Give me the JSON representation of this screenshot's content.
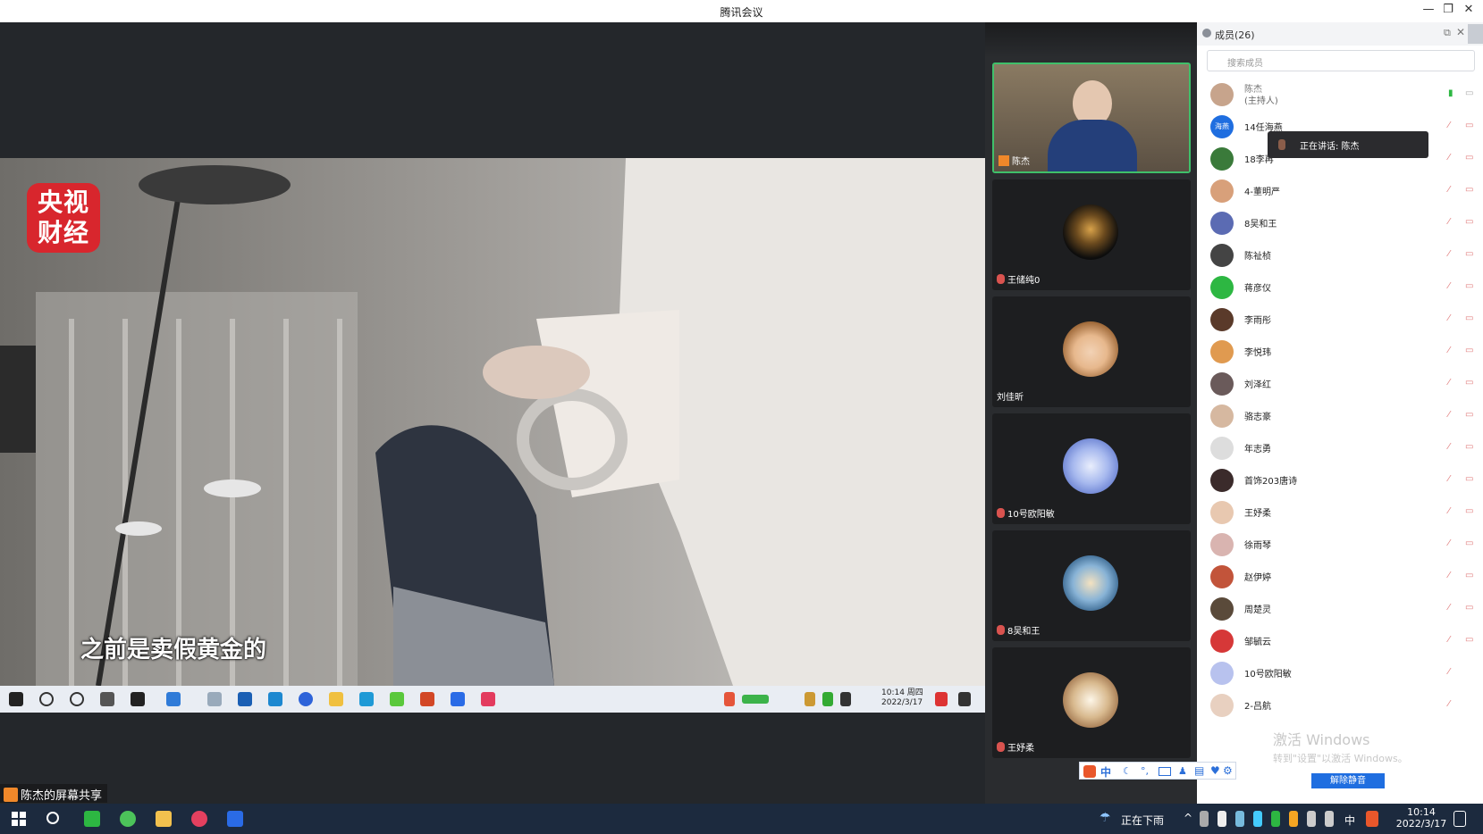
{
  "window": {
    "title": "腾讯会议",
    "controls": [
      "—",
      "❐",
      "✕"
    ]
  },
  "share": {
    "logo_text_1": "央视",
    "logo_text_2": "财经",
    "subtitle": "之前是卖假黄金的",
    "presenter_label": "陈杰的屏幕共享",
    "inner_clock_time": "10:14 周四",
    "inner_clock_date": "2022/3/17"
  },
  "gallery": {
    "tiles": [
      {
        "name": "陈杰",
        "active": true
      },
      {
        "name": "王储纯0"
      },
      {
        "name": "刘佳昕"
      },
      {
        "name": "10号欧阳敏"
      },
      {
        "name": "8吴和王"
      },
      {
        "name": "王妤柔"
      }
    ]
  },
  "members": {
    "title": "成员(26)",
    "search_placeholder": "搜索成员",
    "speaking_label": "正在讲话: 陈杰",
    "list": [
      {
        "name": "陈杰",
        "sub": "(主持人)"
      },
      {
        "name": "14任海燕",
        "avatar_text": "海燕"
      },
      {
        "name": "18李再"
      },
      {
        "name": "4-董明严"
      },
      {
        "name": "8吴和王"
      },
      {
        "name": "陈祉桢"
      },
      {
        "name": "蒋彦仪"
      },
      {
        "name": "李雨彤"
      },
      {
        "name": "李悦玮"
      },
      {
        "name": "刘泽红"
      },
      {
        "name": "骆志豪"
      },
      {
        "name": "年志勇"
      },
      {
        "name": "首饰203唐诗"
      },
      {
        "name": "王妤柔"
      },
      {
        "name": "徐雨琴"
      },
      {
        "name": "赵伊婷"
      },
      {
        "name": "周楚灵"
      },
      {
        "name": "邹毓云"
      },
      {
        "name": "10号欧阳敏"
      },
      {
        "name": "2-吕航"
      }
    ],
    "unmute_all": "解除静音",
    "activate_line1": "激活 Windows",
    "activate_line2": "转到\"设置\"以激活 Windows。"
  },
  "ime": {
    "label": "中"
  },
  "taskbar": {
    "weather": "正在下雨",
    "lang": "中",
    "time": "10:14",
    "date": "2022/3/17"
  }
}
